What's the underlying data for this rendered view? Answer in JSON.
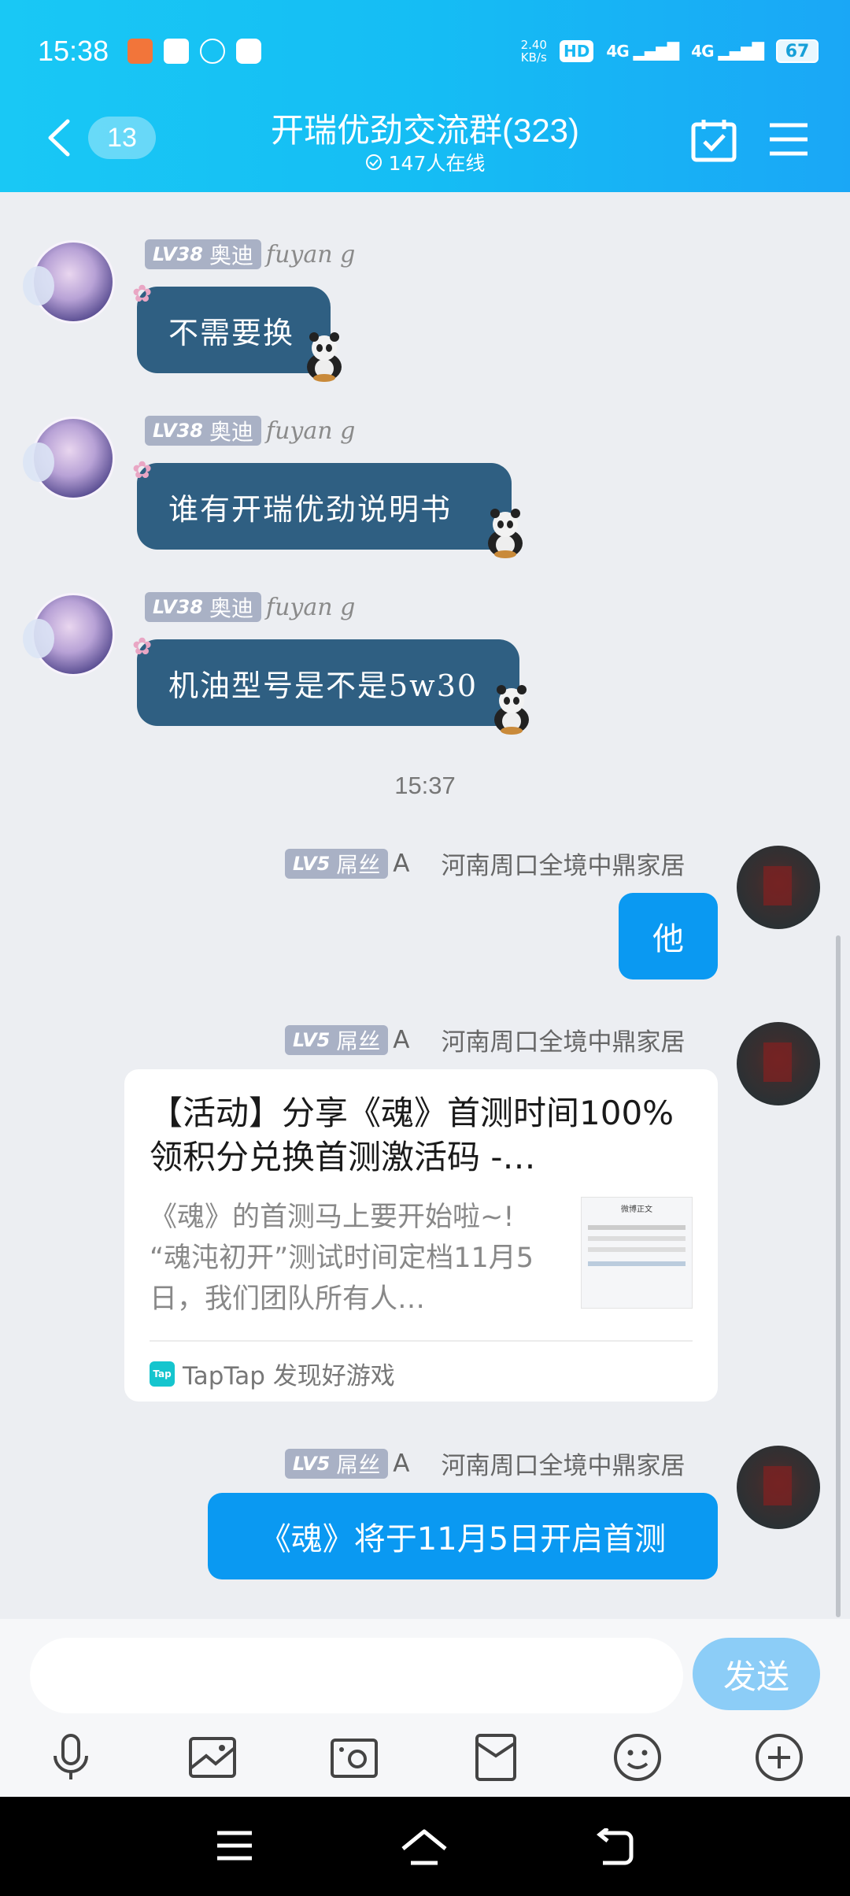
{
  "status_bar": {
    "time": "15:38",
    "net_speed": "2.40",
    "net_unit": "KB/s",
    "hd": "HD",
    "sim1": "4G",
    "sim2": "4G",
    "battery": "67"
  },
  "header": {
    "unread_count": "13",
    "title": "开瑞优劲交流群(323)",
    "online": "147人在线"
  },
  "messages": {
    "m1": {
      "level": "LV38",
      "title": "奥迪",
      "nick": "fuyan g",
      "text": "不需要换"
    },
    "m2": {
      "level": "LV38",
      "title": "奥迪",
      "nick": "fuyan g",
      "text": "谁有开瑞优劲说明书"
    },
    "m3": {
      "level": "LV38",
      "title": "奥迪",
      "nick": "fuyan g",
      "text": "机油型号是不是5w30"
    },
    "time_divider": "15:37",
    "m4": {
      "level": "LV5",
      "title": "屌丝",
      "nick": "A",
      "group": "河南周口全境中鼎家居",
      "text": "他"
    },
    "m5": {
      "level": "LV5",
      "title": "屌丝",
      "nick": "A",
      "group": "河南周口全境中鼎家居",
      "card_title": "【活动】分享《魂》首测时间100%领积分兑换首测激活码 -…",
      "card_body": "《魂》的首测马上要开始啦~! “魂沌初开”测试时间定档11月5日，我们团队所有人…",
      "thumb_title": "微博正文",
      "source_icon": "Tap",
      "source": "TapTap 发现好游戏"
    },
    "m6": {
      "level": "LV5",
      "title": "屌丝",
      "nick": "A",
      "group": "河南周口全境中鼎家居",
      "text": "《魂》将于11月5日开启首测"
    }
  },
  "input": {
    "placeholder": "",
    "send_label": "发送"
  },
  "colors": {
    "header_start": "#19c8f5",
    "header_end": "#1aa7f6",
    "my_bubble": "#0a99f2",
    "art_bubble": "#2f5f82",
    "send_button": "#8ccdf7"
  },
  "icons": [
    "back-chevron-icon",
    "calendar-check-icon",
    "menu-icon",
    "microphone-icon",
    "image-icon",
    "camera-icon",
    "red-packet-icon",
    "emoji-icon",
    "plus-icon"
  ]
}
